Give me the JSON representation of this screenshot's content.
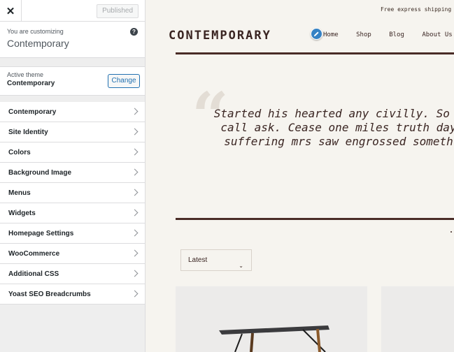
{
  "sidebar": {
    "close_icon": "close-icon",
    "publish_label": "Published",
    "customizing_label": "You are customizing",
    "site_name": "Contemporary",
    "active_theme_label": "Active theme",
    "active_theme_name": "Contemporary",
    "change_label": "Change",
    "items": [
      {
        "label": "Contemporary"
      },
      {
        "label": "Site Identity"
      },
      {
        "label": "Colors"
      },
      {
        "label": "Background Image"
      },
      {
        "label": "Menus"
      },
      {
        "label": "Widgets"
      },
      {
        "label": "Homepage Settings"
      },
      {
        "label": "WooCommerce"
      },
      {
        "label": "Additional CSS"
      },
      {
        "label": "Yoast SEO Breadcrumbs"
      }
    ]
  },
  "preview": {
    "topbar_text": "Free express shipping",
    "logo": "CONTEMPORARY",
    "nav": [
      "Home",
      "Shop",
      "Blog",
      "About Us"
    ],
    "quote_lines": [
      "Started his hearted any civilly. So m",
      "call ask. Cease one miles truth day",
      "suffering mrs saw engrossed someth"
    ],
    "sort_value": "Latest",
    "colors": {
      "brand": "#4a2c27",
      "accent": "#2271b1"
    }
  }
}
